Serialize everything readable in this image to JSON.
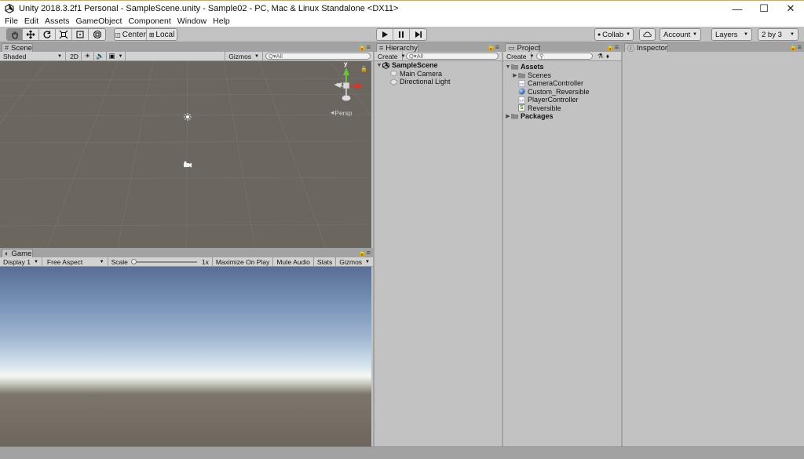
{
  "window": {
    "title": "Unity 2018.3.2f1 Personal - SampleScene.unity - Sample02 - PC, Mac & Linux Standalone <DX11>",
    "controls": {
      "minimize": "—",
      "maximize": "☐",
      "close": "✕"
    }
  },
  "menu": [
    "File",
    "Edit",
    "Assets",
    "GameObject",
    "Component",
    "Window",
    "Help"
  ],
  "toolbar": {
    "pivot_label": "Center",
    "space_label": "Local",
    "collab_label": "Collab",
    "account_label": "Account",
    "layers_label": "Layers",
    "layout_label": "2 by 3"
  },
  "scene": {
    "tab_label": "Scene",
    "shading_mode": "Shaded",
    "mode_2d": "2D",
    "gizmos_label": "Gizmos",
    "search_placeholder": "Q▾All",
    "persp_label": "Persp",
    "gizmo_axis": "y"
  },
  "game": {
    "tab_label": "Game",
    "display": "Display 1",
    "aspect": "Free Aspect",
    "scale_label": "Scale",
    "scale_value": "1x",
    "maximize_on_play": "Maximize On Play",
    "mute_audio": "Mute Audio",
    "stats": "Stats",
    "gizmos": "Gizmos"
  },
  "hierarchy": {
    "tab_label": "Hierarchy",
    "create_label": "Create",
    "search_placeholder": "Q▾All",
    "scene_name": "SampleScene",
    "items": [
      "Main Camera",
      "Directional Light"
    ]
  },
  "project": {
    "tab_label": "Project",
    "create_label": "Create",
    "assets_label": "Assets",
    "packages_label": "Packages",
    "scenes_label": "Scenes",
    "files": [
      {
        "name": "CameraController",
        "icon": "script-icon"
      },
      {
        "name": "Custom_Reversible",
        "icon": "material-icon"
      },
      {
        "name": "PlayerController",
        "icon": "script-icon"
      },
      {
        "name": "Reversible",
        "icon": "shader-icon",
        "badge": "S"
      }
    ]
  },
  "inspector": {
    "tab_label": "Inspector"
  },
  "colors": {
    "scene_background": "#6b6660",
    "panel_background": "#c2c2c2",
    "gizmo_x": "#d9352a",
    "gizmo_y": "#6cc237"
  }
}
